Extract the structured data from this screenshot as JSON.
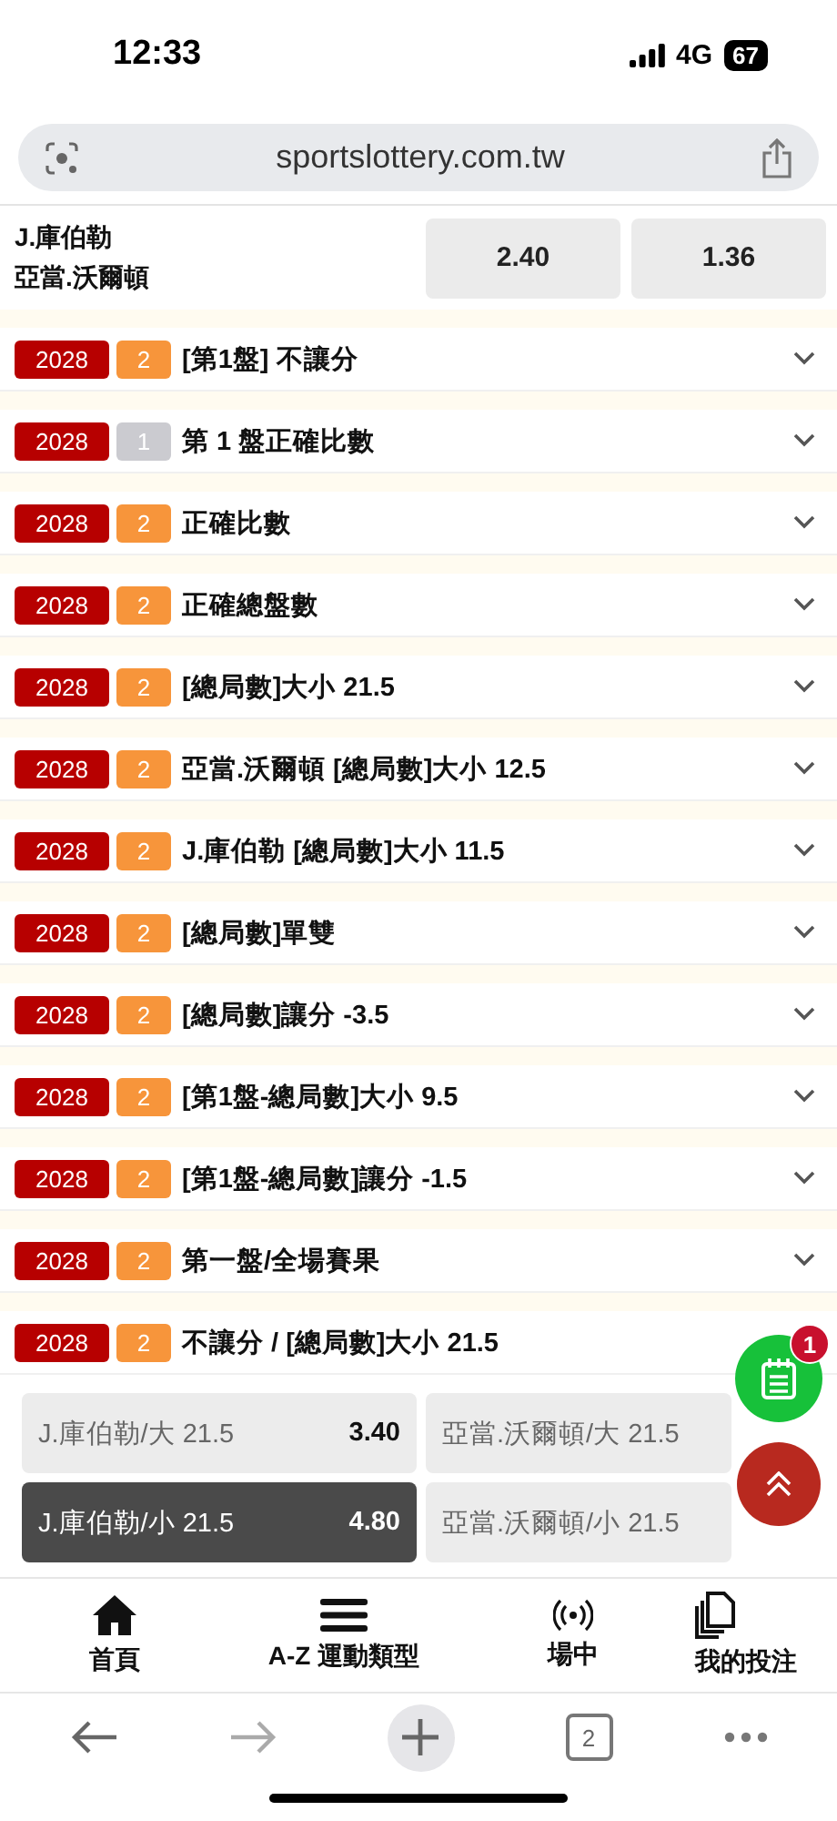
{
  "status_bar": {
    "time": "12:33",
    "network": "4G",
    "battery": "67"
  },
  "address_bar": {
    "url": "sportslottery.com.tw"
  },
  "match": {
    "teams": [
      "J.庫伯勒",
      "亞當.沃爾頓"
    ],
    "odds": [
      "2.40",
      "1.36"
    ]
  },
  "markets": [
    {
      "year": "2028",
      "count": "2",
      "active": true,
      "title": "[第1盤] 不讓分",
      "expanded": false
    },
    {
      "year": "2028",
      "count": "1",
      "active": false,
      "title": "第 1 盤正確比數",
      "expanded": false
    },
    {
      "year": "2028",
      "count": "2",
      "active": true,
      "title": "正確比數",
      "expanded": false
    },
    {
      "year": "2028",
      "count": "2",
      "active": true,
      "title": "正確總盤數",
      "expanded": false
    },
    {
      "year": "2028",
      "count": "2",
      "active": true,
      "title": "[總局數]大小 21.5",
      "expanded": false
    },
    {
      "year": "2028",
      "count": "2",
      "active": true,
      "title": "亞當.沃爾頓 [總局數]大小 12.5",
      "expanded": false
    },
    {
      "year": "2028",
      "count": "2",
      "active": true,
      "title": "J.庫伯勒 [總局數]大小 11.5",
      "expanded": false
    },
    {
      "year": "2028",
      "count": "2",
      "active": true,
      "title": "[總局數]單雙",
      "expanded": false
    },
    {
      "year": "2028",
      "count": "2",
      "active": true,
      "title": "[總局數]讓分 -3.5",
      "expanded": false
    },
    {
      "year": "2028",
      "count": "2",
      "active": true,
      "title": "[第1盤-總局數]大小 9.5",
      "expanded": false
    },
    {
      "year": "2028",
      "count": "2",
      "active": true,
      "title": "[第1盤-總局數]讓分 -1.5",
      "expanded": false
    },
    {
      "year": "2028",
      "count": "2",
      "active": true,
      "title": "第一盤/全場賽果",
      "expanded": false
    },
    {
      "year": "2028",
      "count": "2",
      "active": true,
      "title": "不讓分 / [總局數]大小 21.5",
      "expanded": true,
      "selections": [
        {
          "label": "J.庫伯勒/大 21.5",
          "odds": "3.40",
          "selected": false
        },
        {
          "label": "亞當.沃爾頓/大 21.5",
          "selected": false
        },
        {
          "label": "J.庫伯勒/小 21.5",
          "odds": "4.80",
          "selected": true
        },
        {
          "label": "亞當.沃爾頓/小 21.5",
          "selected": false
        }
      ]
    }
  ],
  "bet_slip_button": {
    "badge": "1"
  },
  "bottom_nav": [
    {
      "kind": "home",
      "label": "首頁"
    },
    {
      "kind": "menu",
      "label": "A-Z 運動類型"
    },
    {
      "kind": "live",
      "label": "場中"
    },
    {
      "kind": "bets",
      "label": "我的投注"
    }
  ],
  "browser_toolbar": {
    "tab_count": "2"
  }
}
